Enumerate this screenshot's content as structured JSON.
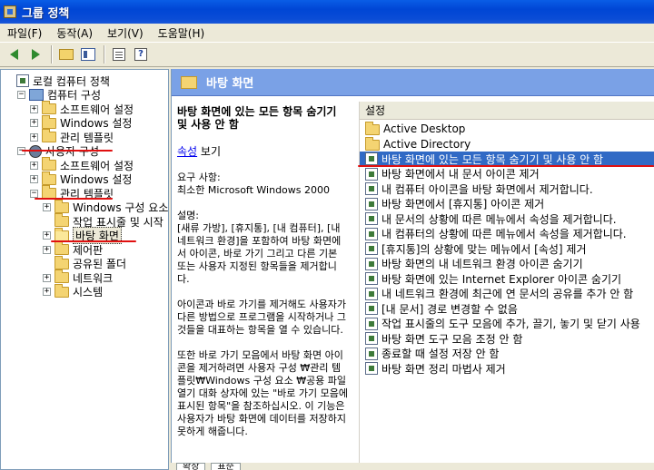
{
  "window": {
    "title": "그룹 정책"
  },
  "menubar": [
    "파일(F)",
    "동작(A)",
    "보기(V)",
    "도움말(H)"
  ],
  "toolbar": {
    "buttons": [
      "back",
      "forward",
      "up-folder",
      "show-tree",
      "properties",
      "help"
    ]
  },
  "tree": [
    {
      "label": "로컬 컴퓨터 정책",
      "level": 0,
      "icon": "policy-icon",
      "expander": ""
    },
    {
      "label": "컴퓨터 구성",
      "level": 1,
      "icon": "computer-icon",
      "expander": "−"
    },
    {
      "label": "소프트웨어 설정",
      "level": 2,
      "icon": "folder-icon",
      "expander": "+"
    },
    {
      "label": "Windows 설정",
      "level": 2,
      "icon": "folder-icon",
      "expander": "+"
    },
    {
      "label": "관리 템플릿",
      "level": 2,
      "icon": "folder-icon",
      "expander": "+"
    },
    {
      "label": "사용자 구성",
      "level": 1,
      "icon": "user-icon",
      "expander": "−"
    },
    {
      "label": "소프트웨어 설정",
      "level": 2,
      "icon": "folder-icon",
      "expander": "+"
    },
    {
      "label": "Windows 설정",
      "level": 2,
      "icon": "folder-icon",
      "expander": "+"
    },
    {
      "label": "관리 템플릿",
      "level": 2,
      "icon": "folder-icon",
      "expander": "−"
    },
    {
      "label": "Windows 구성 요소",
      "level": 3,
      "icon": "folder-icon",
      "expander": "+"
    },
    {
      "label": "작업 표시줄 및 시작",
      "level": 3,
      "icon": "folder-icon",
      "expander": ""
    },
    {
      "label": "바탕 화면",
      "level": 3,
      "icon": "folder-icon",
      "expander": "+",
      "selected": true
    },
    {
      "label": "제어판",
      "level": 3,
      "icon": "folder-icon",
      "expander": "+"
    },
    {
      "label": "공유된 폴더",
      "level": 3,
      "icon": "folder-icon",
      "expander": ""
    },
    {
      "label": "네트워크",
      "level": 3,
      "icon": "folder-icon",
      "expander": "+"
    },
    {
      "label": "시스템",
      "level": 3,
      "icon": "folder-icon",
      "expander": "+"
    }
  ],
  "right_header": {
    "title": "바탕 화면"
  },
  "description": {
    "title": "바탕 화면에 있는 모든 항목 숨기기 및 사용 안 함",
    "properties_link": "속성",
    "properties_suffix": " 보기",
    "requirements": "요구 사항:\n최소한 Microsoft Windows 2000",
    "explanation": "설명:\n[새류 가방], [휴지통], [내 컴퓨터], [내 네트워크 환경]을 포함하여 바탕 화면에서 아이콘, 바로 가기 그리고 다른 기본 또는 사용자 지정된 항목들을 제거합니다.",
    "para2": "아이콘과 바로 가기를 제거해도 사용자가 다른 방법으로 프로그램을 시작하거나 그것들을 대표하는 항목을 열 수 있습니다.",
    "para3": "또한 바로 가기 모음에서 바탕 화면 아이콘을 제거하려면 사용자 구성 ₩관리 템플릿₩Windows 구성 요소 ₩공용 파일 열기 대화 상자에 있는 \"바로 가기 모음에 표시된 항목\"을 참조하십시오. 이 기능은 사용자가 바탕 화면에 데이터를 저장하지 못하게 해줍니다."
  },
  "list": {
    "column_header": "설정",
    "items": [
      {
        "label": "Active Desktop",
        "icon": "folder-icon"
      },
      {
        "label": "Active Directory",
        "icon": "folder-icon"
      },
      {
        "label": "바탕 화면에 있는 모든 항목 숨기기 및 사용 안 함",
        "icon": "policy-icon",
        "selected": true
      },
      {
        "label": "바탕 화면에서 내 문서 아이콘 제거",
        "icon": "policy-icon"
      },
      {
        "label": "내 컴퓨터 아이콘을 바탕 화면에서 제거합니다.",
        "icon": "policy-icon"
      },
      {
        "label": "바탕 화면에서 [휴지통] 아이콘 제거",
        "icon": "policy-icon"
      },
      {
        "label": "내 문서의 상황에 따른 메뉴에서 속성을 제거합니다.",
        "icon": "policy-icon"
      },
      {
        "label": "내 컴퓨터의 상황에 따른 메뉴에서 속성을 제거합니다.",
        "icon": "policy-icon"
      },
      {
        "label": "[휴지통]의 상황에 맞는 메뉴에서 [속성] 제거",
        "icon": "policy-icon"
      },
      {
        "label": "바탕 화면의 내 네트워크 환경 아이콘 숨기기",
        "icon": "policy-icon"
      },
      {
        "label": "바탕 화면에 있는 Internet Explorer 아이콘 숨기기",
        "icon": "policy-icon"
      },
      {
        "label": "내 네트워크 환경에 최근에 연 문서의 공유를 추가 안 함",
        "icon": "policy-icon"
      },
      {
        "label": "[내 문서] 경로 변경할 수 없음",
        "icon": "policy-icon"
      },
      {
        "label": "작업 표시줄의 도구 모음에 추가, 끌기, 놓기 및 닫기 사용",
        "icon": "policy-icon"
      },
      {
        "label": "바탕 화면 도구 모음 조정 안 함",
        "icon": "policy-icon"
      },
      {
        "label": "종료할 때 설정 저장 안 함",
        "icon": "policy-icon"
      },
      {
        "label": "바탕 화면 정리 마법사 제거",
        "icon": "policy-icon"
      }
    ]
  },
  "bottom_tabs": [
    "확장",
    "표준"
  ],
  "colors": {
    "accent": "#316ac5",
    "header_blue": "#7aa1e6",
    "annotation_red": "#e01010"
  }
}
